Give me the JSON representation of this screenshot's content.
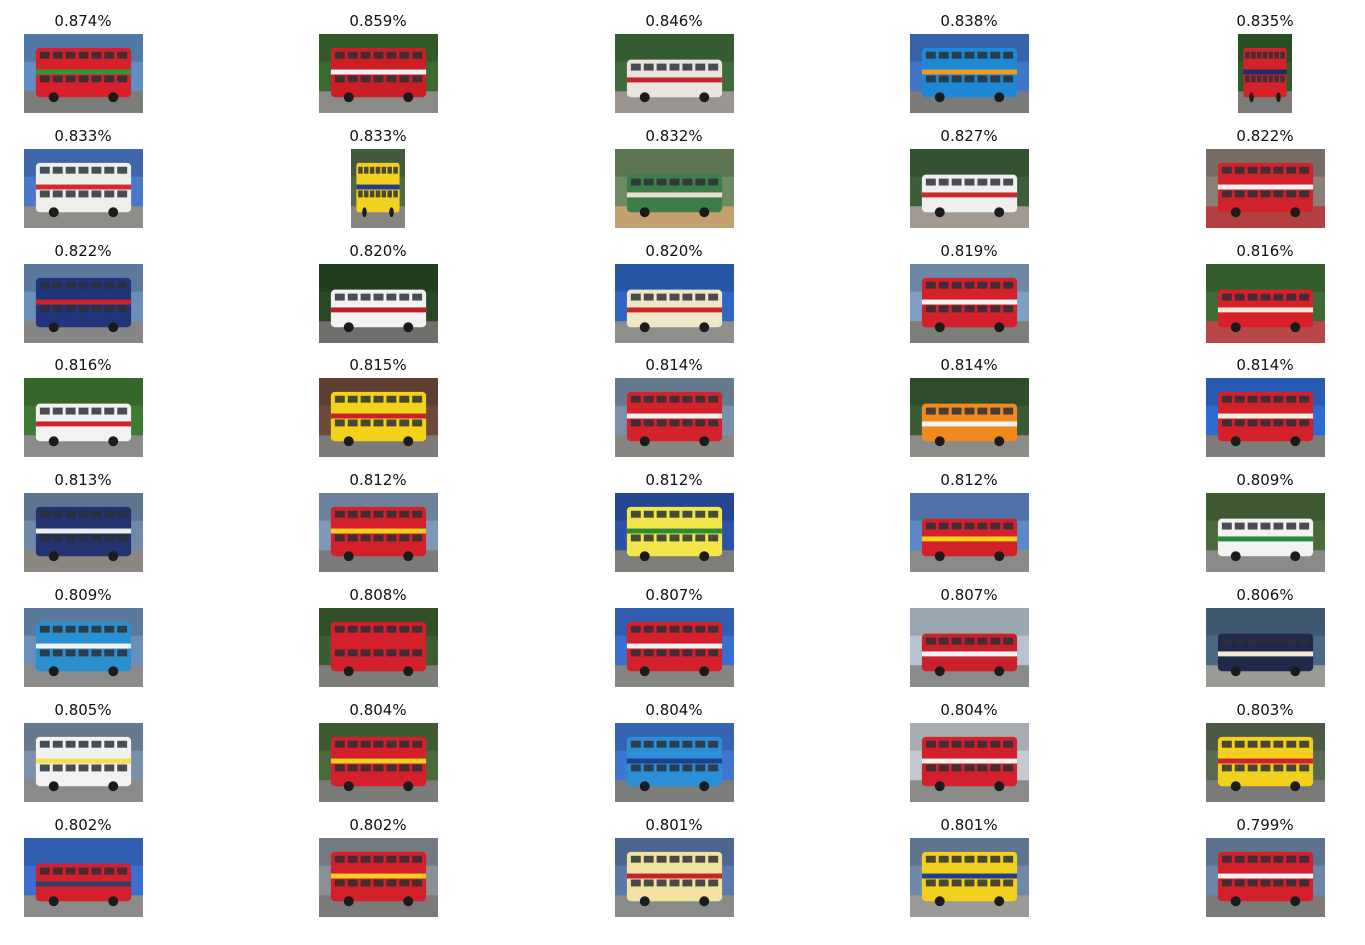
{
  "figure": {
    "rows": [
      [
        {
          "score": "0.874%",
          "sky": "#5f8fc4",
          "ground": "#7c7c78",
          "bus": "#d8202a",
          "band": "#2f9a3a",
          "deck": "double",
          "aspect": "wide"
        },
        {
          "score": "0.859%",
          "sky": "#3a6a2e",
          "ground": "#8a8a86",
          "bus": "#cc1e25",
          "band": "#f2f2f2",
          "deck": "double",
          "aspect": "wide"
        },
        {
          "score": "0.846%",
          "sky": "#3f6b3a",
          "ground": "#9a9590",
          "bus": "#e9e4dc",
          "band": "#c2262e",
          "deck": "single",
          "aspect": "wide"
        },
        {
          "score": "0.838%",
          "sky": "#3f74c9",
          "ground": "#7a7a78",
          "bus": "#1f88d6",
          "band": "#f09a20",
          "deck": "double",
          "aspect": "wide"
        },
        {
          "score": "0.835%",
          "sky": "#2f5c2a",
          "ground": "#7b7b78",
          "bus": "#d3222a",
          "band": "#1e2a6a",
          "deck": "double",
          "aspect": "narrow"
        }
      ],
      [
        {
          "score": "0.833%",
          "sky": "#4a78c8",
          "ground": "#8d8d8a",
          "bus": "#eeeeea",
          "band": "#d32a2a",
          "deck": "double",
          "aspect": "wide"
        },
        {
          "score": "0.833%",
          "sky": "#506a4a",
          "ground": "#868682",
          "bus": "#f2d21e",
          "band": "#243d8f",
          "deck": "double",
          "aspect": "narrow"
        },
        {
          "score": "0.832%",
          "sky": "#6e8a60",
          "ground": "#c3a070",
          "bus": "#3c7d4a",
          "band": "#e8e2cf",
          "deck": "single",
          "aspect": "wide"
        },
        {
          "score": "0.827%",
          "sky": "#3d5e3a",
          "ground": "#a09a92",
          "bus": "#efefef",
          "band": "#c92a2a",
          "deck": "single",
          "aspect": "wide"
        },
        {
          "score": "0.822%",
          "sky": "#8c7f78",
          "ground": "#b24040",
          "bus": "#d2232a",
          "band": "#f2f2f2",
          "deck": "double",
          "aspect": "wide"
        }
      ],
      [
        {
          "score": "0.822%",
          "sky": "#6a8fb8",
          "ground": "#858585",
          "bus": "#21357d",
          "band": "#d8202a",
          "deck": "double",
          "aspect": "wide"
        },
        {
          "score": "0.820%",
          "sky": "#274a24",
          "ground": "#6f6f6c",
          "bus": "#f2f2f2",
          "band": "#b8202a",
          "deck": "single",
          "aspect": "wide"
        },
        {
          "score": "0.820%",
          "sky": "#2f66c4",
          "ground": "#8e8e8a",
          "bus": "#f0e7c6",
          "band": "#c9262a",
          "deck": "single",
          "aspect": "wide"
        },
        {
          "score": "0.819%",
          "sky": "#7fa0c2",
          "ground": "#7d7d7a",
          "bus": "#d3202a",
          "band": "#f4f4f4",
          "deck": "double",
          "aspect": "wide"
        },
        {
          "score": "0.816%",
          "sky": "#3d6b33",
          "ground": "#b84848",
          "bus": "#d8202a",
          "band": "#f2ead2",
          "deck": "single",
          "aspect": "wide"
        }
      ],
      [
        {
          "score": "0.816%",
          "sky": "#3f7a32",
          "ground": "#8a8a88",
          "bus": "#f2f2f2",
          "band": "#d3202a",
          "deck": "single",
          "aspect": "wide"
        },
        {
          "score": "0.815%",
          "sky": "#6f4a3a",
          "ground": "#7a7a78",
          "bus": "#f3d21a",
          "band": "#c7202a",
          "deck": "double",
          "aspect": "wide"
        },
        {
          "score": "0.814%",
          "sky": "#7a8fa8",
          "ground": "#858582",
          "bus": "#d4222b",
          "band": "#f2f2f2",
          "deck": "double",
          "aspect": "wide"
        },
        {
          "score": "0.814%",
          "sky": "#3a5a34",
          "ground": "#8b8b88",
          "bus": "#f08a20",
          "band": "#f2f2f2",
          "deck": "single",
          "aspect": "wide"
        },
        {
          "score": "0.814%",
          "sky": "#2f6ad0",
          "ground": "#7c7c7a",
          "bus": "#d3202a",
          "band": "#f7f0e0",
          "deck": "double",
          "aspect": "wide"
        }
      ],
      [
        {
          "score": "0.813%",
          "sky": "#6f8aa8",
          "ground": "#8a8680",
          "bus": "#22336f",
          "band": "#efefef",
          "deck": "double",
          "aspect": "wide"
        },
        {
          "score": "0.812%",
          "sky": "#7e98b8",
          "ground": "#7a7a78",
          "bus": "#d3202a",
          "band": "#f2d01e",
          "deck": "double",
          "aspect": "wide"
        },
        {
          "score": "0.812%",
          "sky": "#2b52a8",
          "ground": "#7d7d7a",
          "bus": "#f2e64a",
          "band": "#2b8a3a",
          "deck": "double",
          "aspect": "wide"
        },
        {
          "score": "0.812%",
          "sky": "#5d88c6",
          "ground": "#8a8a88",
          "bus": "#d3202a",
          "band": "#f2d01e",
          "deck": "single",
          "aspect": "wide"
        },
        {
          "score": "0.809%",
          "sky": "#4a6a3a",
          "ground": "#8a8a88",
          "bus": "#f2f2f2",
          "band": "#2a8a3a",
          "deck": "single",
          "aspect": "wide"
        }
      ],
      [
        {
          "score": "0.809%",
          "sky": "#6a8fb8",
          "ground": "#8a8a88",
          "bus": "#2a8fcf",
          "band": "#f2f2f2",
          "deck": "double",
          "aspect": "wide"
        },
        {
          "score": "0.808%",
          "sky": "#3a5e2f",
          "ground": "#7c7c78",
          "bus": "#d3202a",
          "band": "#d3202a",
          "deck": "double",
          "aspect": "wide"
        },
        {
          "score": "0.807%",
          "sky": "#3a6ed0",
          "ground": "#858582",
          "bus": "#d3202a",
          "band": "#f2f2f2",
          "deck": "double",
          "aspect": "wide"
        },
        {
          "score": "0.807%",
          "sky": "#b7c3d0",
          "ground": "#8a8a88",
          "bus": "#c9202a",
          "band": "#f2f2f2",
          "deck": "single",
          "aspect": "wide"
        },
        {
          "score": "0.806%",
          "sky": "#4a6a84",
          "ground": "#9a9a96",
          "bus": "#1f2a4a",
          "band": "#f2ead2",
          "deck": "single",
          "aspect": "wide"
        }
      ],
      [
        {
          "score": "0.805%",
          "sky": "#7a8fa8",
          "ground": "#8a8a88",
          "bus": "#f2f2f2",
          "band": "#f0e04a",
          "deck": "double",
          "aspect": "wide"
        },
        {
          "score": "0.804%",
          "sky": "#4a6a3a",
          "ground": "#7a7a78",
          "bus": "#d3202a",
          "band": "#f2d01e",
          "deck": "double",
          "aspect": "wide"
        },
        {
          "score": "0.804%",
          "sky": "#3f76cf",
          "ground": "#7c7c7a",
          "bus": "#2a8fd6",
          "band": "#1f3f8a",
          "deck": "double",
          "aspect": "wide"
        },
        {
          "score": "0.804%",
          "sky": "#c3cad2",
          "ground": "#8a8a88",
          "bus": "#d3202a",
          "band": "#f2f2f2",
          "deck": "double",
          "aspect": "wide"
        },
        {
          "score": "0.803%",
          "sky": "#5a6a52",
          "ground": "#7a7a78",
          "bus": "#f2d01e",
          "band": "#d3202a",
          "deck": "double",
          "aspect": "wide"
        }
      ],
      [
        {
          "score": "0.802%",
          "sky": "#3b6fd2",
          "ground": "#8a8a88",
          "bus": "#d3202a",
          "band": "#2f3f6a",
          "deck": "single",
          "aspect": "wide"
        },
        {
          "score": "0.802%",
          "sky": "#8a8f98",
          "ground": "#7a7a78",
          "bus": "#d3202a",
          "band": "#f2d01e",
          "deck": "double",
          "aspect": "wide"
        },
        {
          "score": "0.801%",
          "sky": "#5a78a8",
          "ground": "#8a8a88",
          "bus": "#f2e2a0",
          "band": "#c9202a",
          "deck": "double",
          "aspect": "wide"
        },
        {
          "score": "0.801%",
          "sky": "#6f8aa8",
          "ground": "#9a9a96",
          "bus": "#f2d01e",
          "band": "#1f3f8a",
          "deck": "double",
          "aspect": "wide"
        },
        {
          "score": "0.799%",
          "sky": "#6d86a8",
          "ground": "#7a7a78",
          "bus": "#d3202a",
          "band": "#f2f2f2",
          "deck": "double",
          "aspect": "wide"
        }
      ]
    ]
  }
}
